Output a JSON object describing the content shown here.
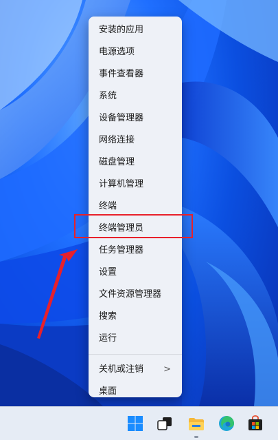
{
  "menu": {
    "items": [
      {
        "label": "安装的应用"
      },
      {
        "label": "电源选项"
      },
      {
        "label": "事件查看器"
      },
      {
        "label": "系统"
      },
      {
        "label": "设备管理器"
      },
      {
        "label": "网络连接"
      },
      {
        "label": "磁盘管理"
      },
      {
        "label": "计算机管理"
      },
      {
        "label": "终端"
      },
      {
        "label": "终端管理员"
      },
      {
        "label": "任务管理器"
      },
      {
        "label": "设置"
      },
      {
        "label": "文件资源管理器"
      },
      {
        "label": "搜索"
      },
      {
        "label": "运行"
      }
    ],
    "shutdown_label": "关机或注销",
    "shutdown_arrow": ">",
    "desktop_label": "桌面"
  },
  "highlight_color": "#e8202a",
  "taskbar": {
    "icons": [
      "windows-start-icon",
      "task-view-icon",
      "file-explorer-icon",
      "edge-browser-icon",
      "microsoft-store-icon"
    ]
  }
}
